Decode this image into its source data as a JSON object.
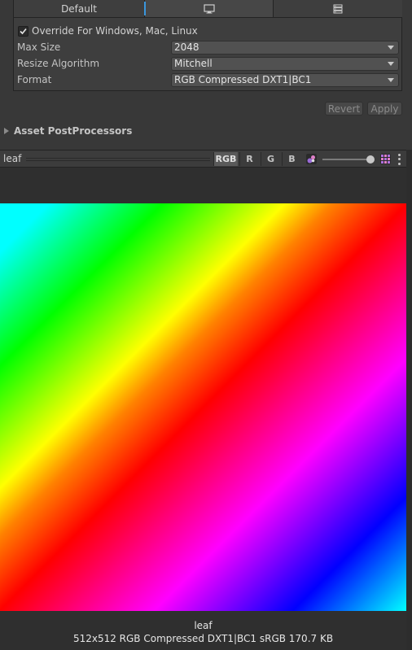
{
  "tabs": [
    {
      "label": "Default",
      "icon": ""
    },
    {
      "label": "",
      "icon": "monitor-icon"
    },
    {
      "label": "",
      "icon": "server-icon"
    }
  ],
  "override": {
    "checked": true,
    "label": "Override For Windows, Mac, Linux"
  },
  "settings": [
    {
      "label": "Max Size",
      "value": "2048"
    },
    {
      "label": "Resize Algorithm",
      "value": "Mitchell"
    },
    {
      "label": "Format",
      "value": "RGB Compressed DXT1|BC1"
    }
  ],
  "buttons": {
    "revert": "Revert",
    "apply": "Apply"
  },
  "foldout": {
    "label": "Asset PostProcessors"
  },
  "preview": {
    "name": "leaf",
    "channels": [
      "RGB",
      "R",
      "G",
      "B"
    ],
    "active_channel": "RGB",
    "mip_level": 0.9
  },
  "footer": {
    "name": "leaf",
    "info": "512x512  RGB Compressed DXT1|BC1 sRGB   170.7 KB"
  },
  "colors": {
    "accent": "#3a96dd",
    "background": "#383838"
  }
}
